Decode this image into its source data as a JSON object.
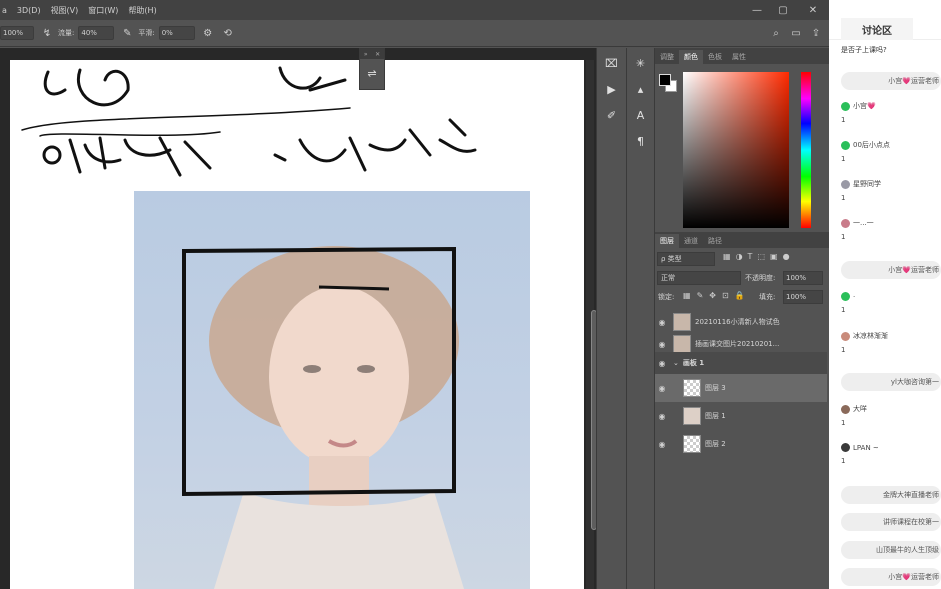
{
  "menubar": {
    "items": [
      "a",
      "3D(D)",
      "视图(V)",
      "窗口(W)",
      "帮助(H)"
    ]
  },
  "options": {
    "zoom": "100%",
    "flow_label": "流量:",
    "flow_value": "40%",
    "smooth_label": "平滑:",
    "smooth_value": "0%"
  },
  "panels": {
    "color_tabs": [
      "调整",
      "颜色",
      "色板",
      "属性"
    ],
    "layer_tabs": [
      "图层",
      "通道",
      "路径"
    ],
    "filter_kind": "ρ 类型",
    "blend_mode": "正常",
    "opacity_label": "不透明度:",
    "opacity_value": "100%",
    "lock_label": "锁定:",
    "fill_label": "填充:",
    "fill_value": "100%"
  },
  "layers": [
    {
      "name": "20210116小清新人物试色",
      "thumb": "photo"
    },
    {
      "name": "插画课交图片20210201...",
      "thumb": "photo"
    },
    {
      "name": "画板 1",
      "thumb": "none"
    },
    {
      "name": "图层 3",
      "thumb": "check"
    },
    {
      "name": "图层 1",
      "thumb": "photo"
    },
    {
      "name": "图层 2",
      "thumb": "check"
    }
  ],
  "chat": {
    "tab_title": "讨论区",
    "top_question": "是否子上课吗?",
    "items": [
      {
        "kind": "pill",
        "text": "小宫💗运营老师"
      },
      {
        "kind": "user",
        "name": "小宫💗",
        "msg": "1",
        "avatar": "#2bbf5a"
      },
      {
        "kind": "user",
        "name": "00后小点点",
        "msg": "1",
        "avatar": "#2bbf5a"
      },
      {
        "kind": "user",
        "name": "星野同学",
        "msg": "1",
        "avatar": "#9a9aa6"
      },
      {
        "kind": "user",
        "name": "一...一",
        "msg": "1",
        "avatar": "#c97b8a"
      },
      {
        "kind": "pill",
        "text": "小宫💗运营老师"
      },
      {
        "kind": "user",
        "name": "·",
        "msg": "1",
        "avatar": "#2bbf5a"
      },
      {
        "kind": "user",
        "name": "冰凉林渐渐",
        "msg": "1",
        "avatar": "#c98b7b"
      },
      {
        "kind": "pill",
        "text": "yl大咖咨询第一"
      },
      {
        "kind": "user",
        "name": "大咩",
        "msg": "1",
        "avatar": "#8a6a5a"
      },
      {
        "kind": "user",
        "name": "LPAN ~",
        "msg": "1",
        "avatar": "#3a3a3a"
      },
      {
        "kind": "pill",
        "text": "金牌大神直播老师"
      },
      {
        "kind": "pill",
        "text": "讲师课程在校第一"
      },
      {
        "kind": "pill",
        "text": "山顶最牛的人生顶级"
      },
      {
        "kind": "pill",
        "text": "小宫💗运营老师"
      }
    ]
  },
  "sketch_text": {
    "line1": "镜 例",
    "line2": "①色彩饱 ②对比点"
  },
  "colors": {
    "app_bg": "#535353",
    "menubar": "#424242",
    "canvas": "#ffffff",
    "selected_layer": "#6a6a6a",
    "chat_pill": "#eeeeee"
  }
}
